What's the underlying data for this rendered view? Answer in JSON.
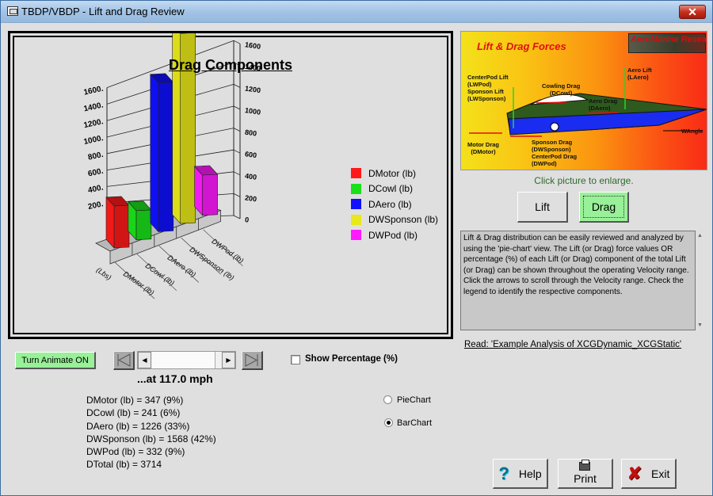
{
  "window": {
    "title": "TBDP/VBDP - Lift and Drag Review",
    "close_label": "✕"
  },
  "chart_data": {
    "type": "bar",
    "style": "3d",
    "title": "Drag Components",
    "xlabel": "",
    "ylabel": "(Lbs)",
    "categories": [
      "DMotor (lb)",
      "DCowl (lb)",
      "DAero (lb)",
      "DWSponson (lb)",
      "DWPod (lb)"
    ],
    "values": [
      347,
      241,
      1226,
      1568,
      332
    ],
    "colors": [
      "#ff1a1a",
      "#1ae01a",
      "#1010ff",
      "#e8e81a",
      "#ff1aff"
    ],
    "ylim": [
      0,
      1600
    ],
    "left_ticks": [
      "200.",
      "400.",
      "600.",
      "800.",
      "1000.",
      "1200.",
      "1400.",
      "1600."
    ],
    "right_ticks": [
      "0",
      "200",
      "400",
      "600",
      "800",
      "1000",
      "1200",
      "1400",
      "1600"
    ],
    "grid": true,
    "legend": "right"
  },
  "diagram": {
    "title": "Lift & Drag Forces",
    "logo": "AeroMarine Research",
    "labels": {
      "centerpod_lift": "CenterPod Lift",
      "lwpod": "(LWPod)",
      "sponson_lift": "Sponson Lift",
      "lwsponson": "(LWSponson)",
      "cowling_drag": "Cowling Drag",
      "dcowl": "(DCowl)",
      "aero_drag": "Aero Drag",
      "daero": "(DAero)",
      "aero_lift": "Aero Lift",
      "laero": "(LAero)",
      "motor_drag": "Motor Drag",
      "dmotor": "(DMotor)",
      "sponson_drag": "Sponson Drag",
      "dwsponson": "(DWSponson)",
      "centerpod_drag": "CenterPod Drag",
      "dwpod": "(DWPod)",
      "wangle": "WAngle"
    },
    "hint": "Click picture to enlarge."
  },
  "buttons": {
    "lift": "Lift",
    "drag": "Drag",
    "animate": "Turn Animate ON",
    "help": "Help",
    "print": "Print",
    "exit": "Exit"
  },
  "description": "Lift & Drag distribution can be easily reviewed and analyzed by using the 'pie-chart' view.  The Lift (or Drag) force values OR percentage (%) of each Lift (or Drag) component of the total Lift (or Drag) can be shown throughout the operating Velocity range.  Click the arrows to scroll through the Velocity range.  Check the legend to identify the respective components.",
  "read_link": "Read: 'Example Analysis of XCGDynamic_XCGStatic'",
  "velocity": {
    "readout": "...at 117.0 mph"
  },
  "options": {
    "show_percentage_label": "Show Percentage (%)",
    "show_percentage_checked": false,
    "pie_label": "PieChart",
    "bar_label": "BarChart",
    "selected": "BarChart"
  },
  "values_list": [
    "DMotor (lb) = 347 (9%)",
    "DCowl (lb) = 241 (6%)",
    "DAero (lb) = 1226 (33%)",
    "DWSponson (lb) = 1568 (42%)",
    "DWPod (lb) = 332 (9%)",
    "DTotal (lb) = 3714"
  ]
}
